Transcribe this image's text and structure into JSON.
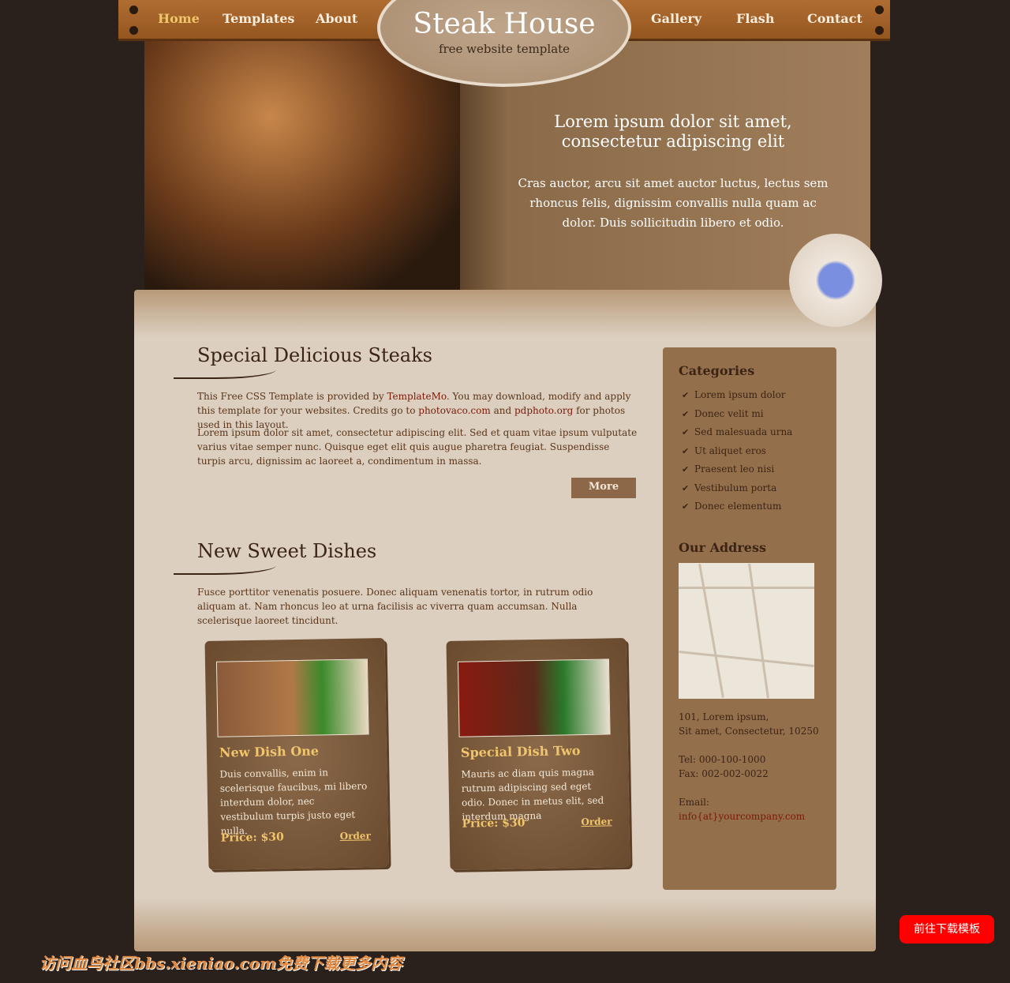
{
  "nav": {
    "items": [
      "Home",
      "Templates",
      "About",
      "Gallery",
      "Flash",
      "Contact"
    ],
    "active": "Home",
    "active_color": "#f1c56c"
  },
  "logo": {
    "title": "Steak House",
    "subtitle": "free website template"
  },
  "banner": {
    "title": "Lorem ipsum dolor sit amet, consectetur adipiscing elit",
    "text": "Cras auctor, arcu sit amet auctor luctus, lectus sem rhoncus felis, dignissim convallis nulla quam ac dolor. Duis sollicitudin libero et odio."
  },
  "section1": {
    "title": "Special Delicious Steaks",
    "p1a": "This Free CSS Template is provided by ",
    "link1": "TemplateMo",
    "p1b": ". You may download, modify and apply this template for your websites. Credits go to ",
    "link2": "photovaco.com",
    "p1c": " and ",
    "link3": "pdphoto.org",
    "p1d": " for photos used in this layout.",
    "p2": "Lorem ipsum dolor sit amet, consectetur adipiscing elit. Sed et quam vitae ipsum vulputate varius vitae semper nunc. Quisque eget elit quis augue pharetra feugiat. Suspendisse turpis arcu, dignissim ac laoreet a, condimentum in massa.",
    "more": "More"
  },
  "section2": {
    "title": "New Sweet Dishes",
    "text": "Fusce porttitor venenatis posuere. Donec aliquam venenatis tortor, in rutrum odio aliquam at. Nam rhoncus leo at urna facilisis ac viverra quam accumsan. Nulla scelerisque laoreet tincidunt."
  },
  "dishes": [
    {
      "name": "New Dish One",
      "desc": "Duis convallis, enim in scelerisque faucibus, mi libero interdum dolor, nec vestibulum turpis justo eget nulla.",
      "price": "Price: $30",
      "order": "Order"
    },
    {
      "name": "Special Dish Two",
      "desc": "Mauris ac diam quis magna rutrum adipiscing sed eget odio. Donec in metus elit, sed interdum magna",
      "price": "Price: $30",
      "order": "Order"
    }
  ],
  "sidebar": {
    "categories_title": "Categories",
    "categories": [
      "Lorem ipsum dolor",
      "Donec velit mi",
      "Sed malesuada urna",
      "Ut aliquet eros",
      "Praesent leo nisi",
      "Vestibulum porta",
      "Donec elementum"
    ],
    "address_title": "Our Address",
    "address1": "101, Lorem ipsum,",
    "address2": "Sit amet, Consectetur, 10250",
    "tel": "Tel: 000-100-1000",
    "fax": "Fax: 002-002-0022",
    "email_label": "Email:",
    "email": "info{at}yourcompany.com"
  },
  "watermark": "访问血鸟社区bbs.xieniao.com免费下载更多内容",
  "download_button": "前往下载模板"
}
